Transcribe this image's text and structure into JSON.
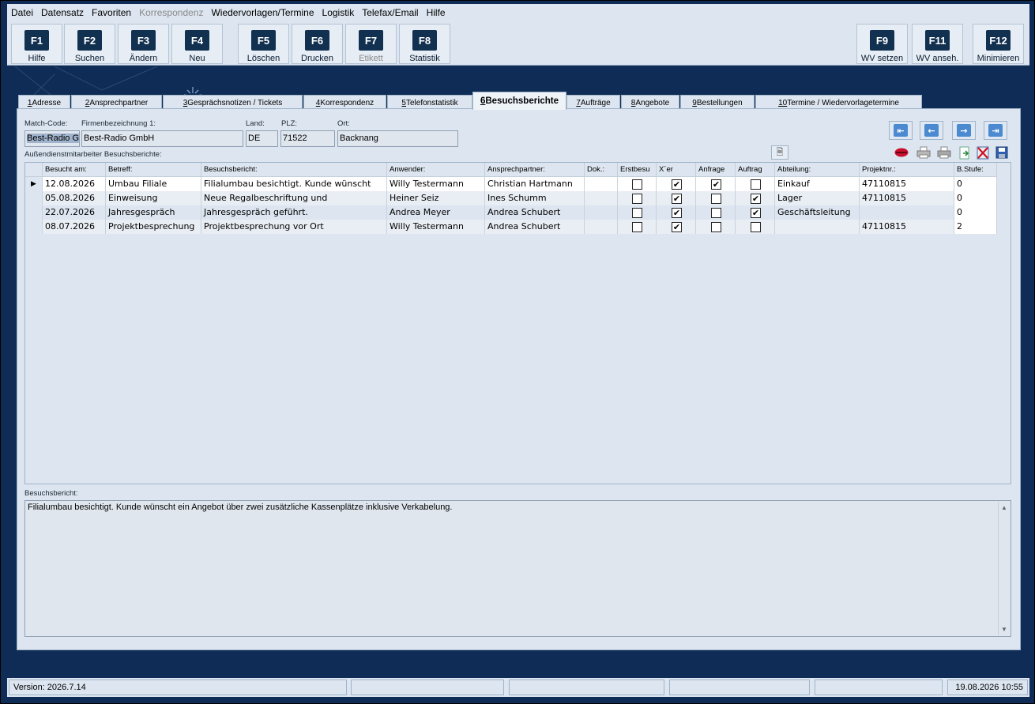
{
  "menu": [
    "Datei",
    "Datensatz",
    "Favoriten",
    "Korrespondenz",
    "Wiedervorlagen/Termine",
    "Logistik",
    "Telefax/Email",
    "Hilfe"
  ],
  "fkeys": [
    {
      "key": "F1",
      "label": "Hilfe"
    },
    {
      "key": "F2",
      "label": "Suchen"
    },
    {
      "key": "F3",
      "label": "Ändern"
    },
    {
      "key": "F4",
      "label": "Neu"
    },
    {
      "key": "F5",
      "label": "Löschen"
    },
    {
      "key": "F6",
      "label": "Drucken"
    },
    {
      "key": "F7",
      "label": "Etikett"
    },
    {
      "key": "F8",
      "label": "Statistik"
    },
    {
      "key": "F9",
      "label": "WV setzen"
    },
    {
      "key": "F11",
      "label": "WV anseh."
    },
    {
      "key": "F12",
      "label": "Minimieren"
    }
  ],
  "tabs": [
    {
      "num": "1",
      "label": " Adresse"
    },
    {
      "num": "2",
      "label": " Ansprechpartner"
    },
    {
      "num": "3",
      "label": " Gesprächsnotizen / Tickets"
    },
    {
      "num": "4",
      "label": " Korrespondenz"
    },
    {
      "num": "5",
      "label": " Telefonstatistik"
    },
    {
      "num": "6",
      "label": " Besuchsberichte"
    },
    {
      "num": "7",
      "label": " Aufträge"
    },
    {
      "num": "8",
      "label": " Angebote"
    },
    {
      "num": "9",
      "label": " Bestellungen"
    },
    {
      "num": "10",
      "label": " Termine / Wiedervorlagetermine"
    }
  ],
  "header": {
    "matchcode_label": "Match-Code:",
    "firma_label": "Firmenbezeichnung 1:",
    "land_label": "Land:",
    "plz_label": "PLZ:",
    "ort_label": "Ort:",
    "matchcode": "Best-Radio Gr",
    "firma": "Best-Radio GmbH",
    "land": "DE",
    "plz": "71522",
    "ort": "Backnang",
    "section_label": "Außendienstmitarbeiter Besuchsberichte:"
  },
  "grid": {
    "columns": [
      "Besucht am:",
      "Betreff:",
      "Besuchsbericht:",
      "Anwender:",
      "Ansprechpartner:",
      "Dok.:",
      "Erstbesu",
      "X´er",
      "Anfrage",
      "Auftrag",
      "Abteilung:",
      "Projektnr.:",
      "B.Stufe:"
    ],
    "rows": [
      {
        "date": "12.08.2026",
        "subject": "Umbau Filiale",
        "report": "Filialumbau besichtigt. Kunde wünscht",
        "user": "Willy Testermann",
        "contact": "Christian Hartmann",
        "dok": "",
        "erst": false,
        "xer": true,
        "anfrage": true,
        "auftrag": false,
        "abteilung": "Einkauf",
        "projekt": "47110815",
        "stufe": "0"
      },
      {
        "date": "05.08.2026",
        "subject": "Einweisung",
        "report": "Neue Regalbeschriftung und",
        "user": "Heiner Seiz",
        "contact": "Ines Schumm",
        "dok": "",
        "erst": false,
        "xer": true,
        "anfrage": false,
        "auftrag": true,
        "abteilung": "Lager",
        "projekt": "47110815",
        "stufe": "0"
      },
      {
        "date": "22.07.2026",
        "subject": "Jahresgespräch",
        "report": "Jahresgespräch geführt.",
        "user": "Andrea Meyer",
        "contact": "Andrea Schubert",
        "dok": "",
        "erst": false,
        "xer": true,
        "anfrage": false,
        "auftrag": true,
        "abteilung": "Geschäftsleitung",
        "projekt": "",
        "stufe": "0"
      },
      {
        "date": "08.07.2026",
        "subject": "Projektbesprechung",
        "report": "Projektbesprechung vor Ort",
        "user": "Willy Testermann",
        "contact": "Andrea Schubert",
        "dok": "",
        "erst": false,
        "xer": true,
        "anfrage": false,
        "auftrag": false,
        "abteilung": "",
        "projekt": "47110815",
        "stufe": "2"
      }
    ]
  },
  "memo": {
    "label": "Besuchsbericht:",
    "text": "Filialumbau besichtigt. Kunde wünscht ein Angebot über zwei zusätzliche Kassenplätze inklusive Verkabelung."
  },
  "status": {
    "version": "Version: 2026.7.14",
    "datetime": "19.08.2026 10:55"
  },
  "icons": [
    "first-record-icon",
    "previous-record-icon",
    "next-record-icon",
    "last-record-icon",
    "attach-document-icon",
    "speech-lips-icon",
    "print-icon",
    "print-preview-icon",
    "export-icon",
    "delete-icon",
    "save-icon"
  ],
  "colors": {
    "window_bg": "#0e2c55",
    "panel_bg": "#dde6f0",
    "fkey_cap": "#12304f",
    "nav_blue": "#4b8ad0"
  }
}
